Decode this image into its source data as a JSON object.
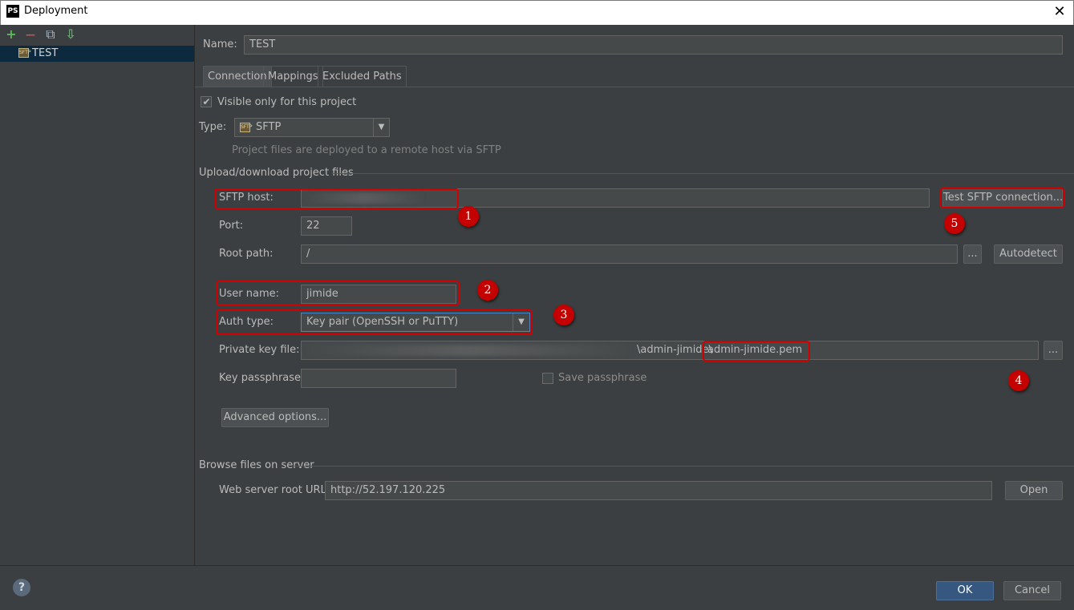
{
  "window": {
    "title": "Deployment",
    "app_icon_text": "PS",
    "close_glyph": "✕"
  },
  "toolbar": {
    "add_glyph": "+",
    "remove_glyph": "—",
    "copy_glyph": "⧉",
    "import_glyph": "⇩"
  },
  "servers": [
    {
      "name": "TEST",
      "icon": "sftp-server-icon"
    }
  ],
  "form": {
    "name_label": "Name:",
    "name_value": "TEST",
    "tabs": [
      "Connection",
      "Mappings",
      "Excluded Paths"
    ],
    "visible_only_label": "Visible only for this project",
    "visible_only_checked": true,
    "type_label": "Type:",
    "type_value": "SFTP",
    "type_hint": "Project files are deployed to a remote host via SFTP",
    "upload_section": "Upload/download project files",
    "sftp_host_label": "SFTP host:",
    "sftp_host_value": "",
    "test_button": "Test SFTP connection...",
    "port_label": "Port:",
    "port_value": "22",
    "root_path_label": "Root path:",
    "root_path_value": "/",
    "browse_glyph": "...",
    "autodetect_button": "Autodetect",
    "user_name_label": "User name:",
    "user_name_value": "jimide",
    "auth_type_label": "Auth type:",
    "auth_type_value": "Key pair (OpenSSH or PuTTY)",
    "private_key_label": "Private key file:",
    "private_key_prefix": "\\admin-jimide\\",
    "private_key_file": "admin-jimide.pem",
    "passphrase_label": "Key passphrase:",
    "passphrase_value": "",
    "save_passphrase_label": "Save passphrase",
    "save_passphrase_checked": false,
    "advanced_button": "Advanced options...",
    "browse_section": "Browse files on server",
    "web_root_label": "Web server root URL:",
    "web_root_value": "http://52.197.120.225",
    "open_button": "Open"
  },
  "annotations": [
    "1",
    "2",
    "3",
    "4",
    "5"
  ],
  "footer": {
    "help_glyph": "?",
    "ok_button": "OK",
    "cancel_button": "Cancel"
  },
  "colors": {
    "background": "#3c3f41",
    "annotation": "#d40000",
    "selection": "#0d293e",
    "primary_button": "#365880"
  }
}
